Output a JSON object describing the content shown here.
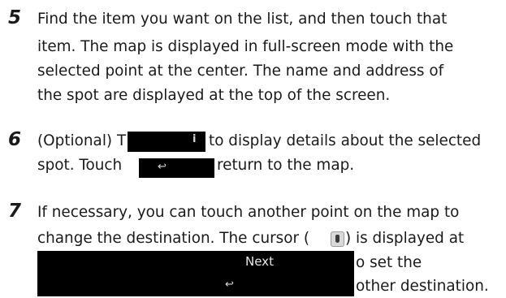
{
  "steps": [
    {
      "number": "5",
      "lines": [
        "Find the item you want on the list, and then touch that",
        "item. The map is displayed in full-screen mode with the",
        "selected point at the center. The name and address of",
        "the spot are displayed at the top of the screen."
      ]
    },
    {
      "number": "6",
      "line1_before": "(Optional) T",
      "line1_after": "to display details about the selected",
      "line2_before": "spot. Touch",
      "line2_after": "return to the map."
    },
    {
      "number": "7",
      "lines": [
        "If necessary, you can touch another point on the map to",
        "change the destination. The cursor (",
        ") is displayed at",
        "o set the",
        "other destination."
      ]
    }
  ],
  "buttons": {
    "info_glyph": "i",
    "back_glyph": "↩",
    "next_label": "Next",
    "back_glyph_2": "↩"
  }
}
